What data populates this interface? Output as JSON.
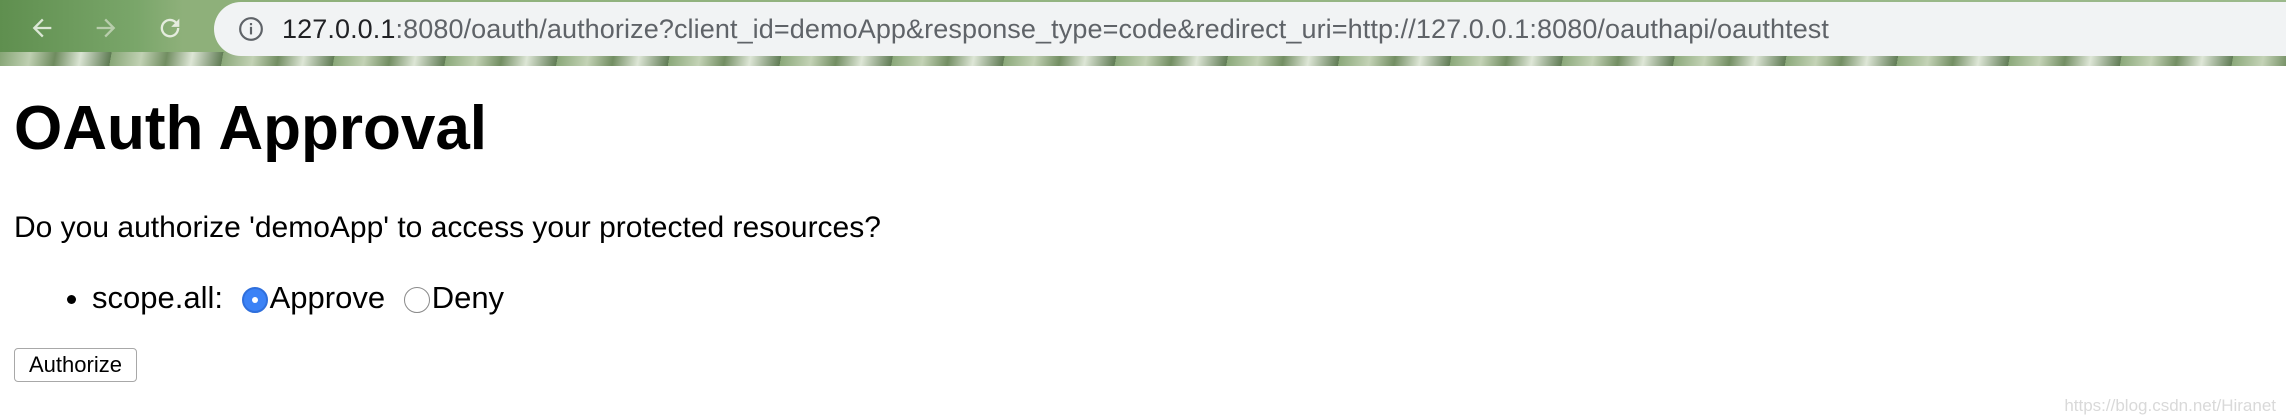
{
  "browser": {
    "url_host": "127.0.0.1",
    "url_rest": ":8080/oauth/authorize?client_id=demoApp&response_type=code&redirect_uri=http://127.0.0.1:8080/oauthapi/oauthtest",
    "icons": [
      "back-arrow-icon",
      "forward-arrow-icon",
      "reload-icon",
      "info-icon"
    ]
  },
  "page": {
    "title": "OAuth Approval",
    "question": "Do you authorize 'demoApp' to access your protected resources?",
    "scopes": [
      {
        "label": "scope.all:",
        "options": [
          {
            "label": "Approve",
            "checked": true
          },
          {
            "label": "Deny",
            "checked": false
          }
        ]
      }
    ],
    "submit_label": "Authorize"
  },
  "watermark": "https://blog.csdn.net/Hiranet",
  "colors": {
    "radio_checked": "#3b82f6",
    "url_bar": "#f1f3f4"
  }
}
